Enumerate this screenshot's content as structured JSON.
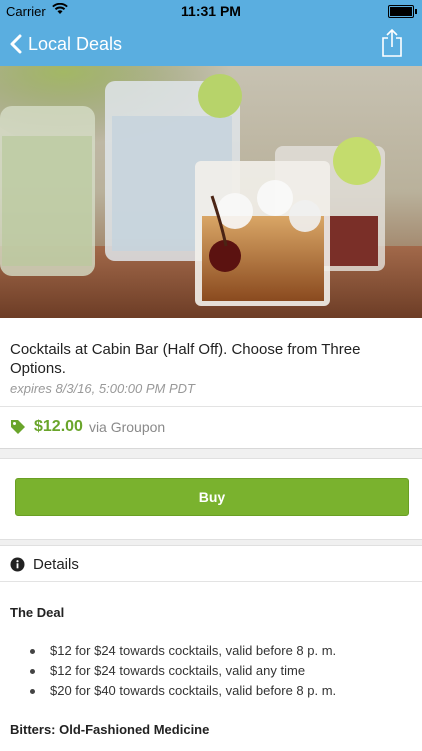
{
  "status_bar": {
    "carrier": "Carrier",
    "time": "11:31 PM"
  },
  "nav": {
    "back_label": "Local Deals"
  },
  "deal": {
    "title": "Cocktails at Cabin Bar (Half Off). Choose from Three Options.",
    "expires": "expires 8/3/16, 5:00:00 PM PDT",
    "price": "$12.00",
    "via": "via Groupon"
  },
  "buy": {
    "label": "Buy"
  },
  "details": {
    "header": "Details",
    "deal_heading": "The Deal",
    "options": [
      "$12 for $24 towards cocktails, valid before 8 p. m.",
      "$12 for $24 towards cocktails, valid any time",
      "$20 for $40 towards cocktails, valid before 8 p. m."
    ],
    "next_heading": "Bitters: Old-Fashioned Medicine"
  },
  "colors": {
    "header_bg": "#5aaee0",
    "price": "#6aa52b",
    "buy_button": "#7ab22e"
  }
}
